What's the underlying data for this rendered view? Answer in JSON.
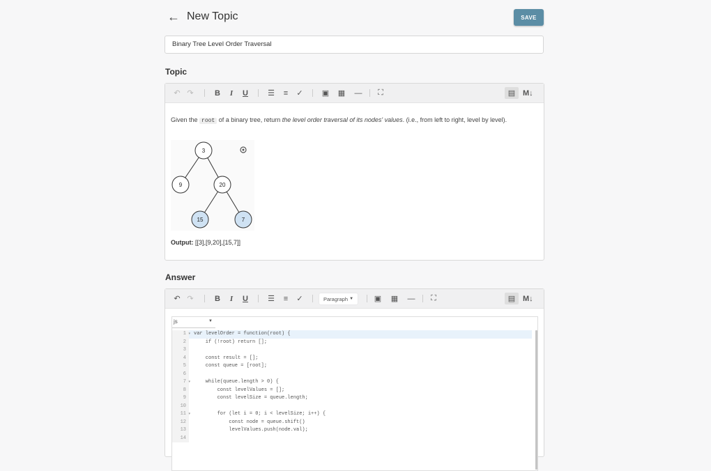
{
  "header": {
    "back_icon": "arrow-left-icon",
    "title": "New Topic",
    "save_label": "SAVE"
  },
  "topic_name": {
    "value": "Binary Tree Level Order Traversal"
  },
  "topic_section": {
    "label": "Topic",
    "description": {
      "prefix": "Given the ",
      "code": "root",
      "middle": " of a binary tree, return ",
      "italic": "the level order traversal of its nodes' values",
      "suffix": ". (i.e., from left to right, level by level)."
    },
    "tree": {
      "nodes": [
        {
          "label": "3",
          "highlighted": false
        },
        {
          "label": "9",
          "highlighted": false
        },
        {
          "label": "20",
          "highlighted": false
        },
        {
          "label": "15",
          "highlighted": true
        },
        {
          "label": "7",
          "highlighted": true
        }
      ],
      "highlight_color": "#cfe2f3"
    },
    "output_label": "Output:",
    "output_value": " [[3],[9,20],[15,7]]"
  },
  "answer_section": {
    "label": "Answer",
    "paragraph_select": "Paragraph",
    "code_language": "js",
    "code_lines": [
      "var levelOrder = function(root) {",
      "    if (!root) return [];",
      "",
      "    const result = [];",
      "    const queue = [root];",
      "",
      "    while(queue.length > 0) {",
      "        const levelValues = [];",
      "        const levelSize = queue.length;",
      "",
      "        for (let i = 0; i < levelSize; i++) {",
      "            const node = queue.shift()",
      "            levelValues.push(node.val);",
      ""
    ],
    "line_numbers": [
      "1",
      "2",
      "3",
      "4",
      "5",
      "6",
      "7",
      "8",
      "9",
      "10",
      "11",
      "12",
      "13",
      "14"
    ]
  },
  "toolbar": {
    "markdown_label": "M↓"
  },
  "colors": {
    "save_button": "#5b8da5",
    "page_background": "#f7f7f8"
  }
}
